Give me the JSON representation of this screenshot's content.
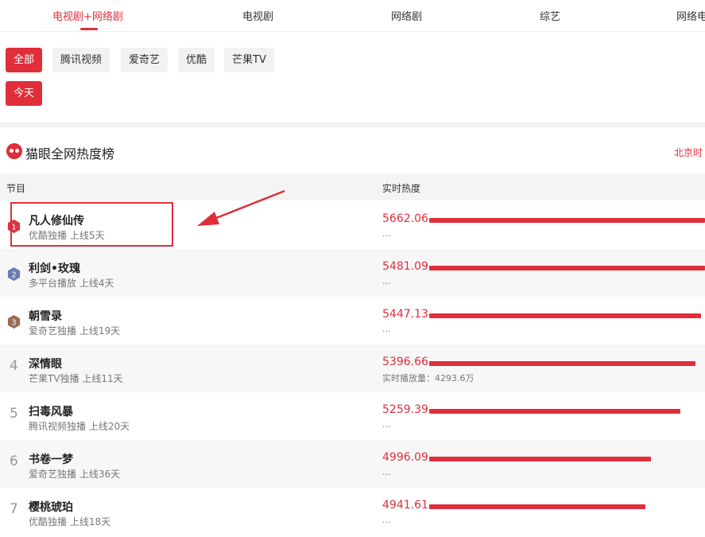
{
  "top_tabs": [
    {
      "label": "电视剧+网络剧",
      "active": true
    },
    {
      "label": "电视剧",
      "active": false
    },
    {
      "label": "网络剧",
      "active": false
    },
    {
      "label": "综艺",
      "active": false
    },
    {
      "label": "网络电",
      "active": false
    }
  ],
  "platform_filters": [
    "全部",
    "腾讯视频",
    "爱奇艺",
    "优酷",
    "芒果TV"
  ],
  "date_filter": "今天",
  "section": {
    "title": "猫眼全网热度榜",
    "time_label": "北京时"
  },
  "table": {
    "col_program": "节目",
    "col_heat": "实时热度"
  },
  "ranking": [
    {
      "rank": "1",
      "title": "凡人修仙传",
      "sub": "优酷独播 上线5天",
      "heat": "5662.06",
      "heat_value": 5662.06,
      "extra": "..."
    },
    {
      "rank": "2",
      "title": "利剑•玫瑰",
      "sub": "多平台播放 上线4天",
      "heat": "5481.09",
      "heat_value": 5481.09,
      "extra": "..."
    },
    {
      "rank": "3",
      "title": "朝雪录",
      "sub": "爱奇艺独播 上线19天",
      "heat": "5447.13",
      "heat_value": 5447.13,
      "extra": "..."
    },
    {
      "rank": "4",
      "title": "深情眼",
      "sub": "芒果TV独播 上线11天",
      "heat": "5396.66",
      "heat_value": 5396.66,
      "extra": "实时播放量：4293.6万"
    },
    {
      "rank": "5",
      "title": "扫毒风暴",
      "sub": "腾讯视频独播 上线20天",
      "heat": "5259.39",
      "heat_value": 5259.39,
      "extra": "..."
    },
    {
      "rank": "6",
      "title": "书卷一梦",
      "sub": "爱奇艺独播 上线36天",
      "heat": "4996.09",
      "heat_value": 4996.09,
      "extra": "..."
    },
    {
      "rank": "7",
      "title": "樱桃琥珀",
      "sub": "优酷独播 上线18天",
      "heat": "4941.61",
      "heat_value": 4941.61,
      "extra": "..."
    }
  ],
  "colors": {
    "accent": "#e02e3b",
    "rank1": "#d9363e",
    "rank2": "#6b7bb0",
    "rank3": "#9a6b50"
  },
  "icons": {
    "section_logo": "maoyan-cat-icon",
    "annotation": "red-arrow-pointer"
  }
}
